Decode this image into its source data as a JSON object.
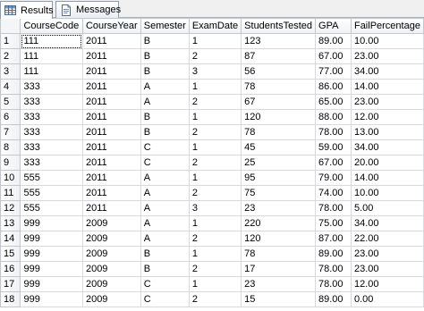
{
  "tabs": [
    {
      "label": "Results",
      "icon": "grid-results-icon",
      "active": true
    },
    {
      "label": "Messages",
      "icon": "messages-icon",
      "active": false
    }
  ],
  "grid": {
    "columns": [
      "CourseCode",
      "CourseYear",
      "Semester",
      "ExamDate",
      "StudentsTested",
      "GPA",
      "FailPercentage"
    ],
    "rows": [
      {
        "num": "1",
        "cells": [
          "111",
          "2011",
          "B",
          "1",
          "123",
          "89.00",
          "10.00"
        ]
      },
      {
        "num": "2",
        "cells": [
          "111",
          "2011",
          "B",
          "2",
          "87",
          "67.00",
          "23.00"
        ]
      },
      {
        "num": "3",
        "cells": [
          "111",
          "2011",
          "B",
          "3",
          "56",
          "77.00",
          "34.00"
        ]
      },
      {
        "num": "4",
        "cells": [
          "333",
          "2011",
          "A",
          "1",
          "78",
          "86.00",
          "14.00"
        ]
      },
      {
        "num": "5",
        "cells": [
          "333",
          "2011",
          "A",
          "2",
          "67",
          "65.00",
          "23.00"
        ]
      },
      {
        "num": "6",
        "cells": [
          "333",
          "2011",
          "B",
          "1",
          "120",
          "88.00",
          "12.00"
        ]
      },
      {
        "num": "7",
        "cells": [
          "333",
          "2011",
          "B",
          "2",
          "78",
          "78.00",
          "13.00"
        ]
      },
      {
        "num": "8",
        "cells": [
          "333",
          "2011",
          "C",
          "1",
          "45",
          "59.00",
          "34.00"
        ]
      },
      {
        "num": "9",
        "cells": [
          "333",
          "2011",
          "C",
          "2",
          "25",
          "67.00",
          "20.00"
        ]
      },
      {
        "num": "10",
        "cells": [
          "555",
          "2011",
          "A",
          "1",
          "95",
          "79.00",
          "14.00"
        ]
      },
      {
        "num": "11",
        "cells": [
          "555",
          "2011",
          "A",
          "2",
          "75",
          "74.00",
          "10.00"
        ]
      },
      {
        "num": "12",
        "cells": [
          "555",
          "2011",
          "A",
          "3",
          "23",
          "78.00",
          "5.00"
        ]
      },
      {
        "num": "13",
        "cells": [
          "999",
          "2009",
          "A",
          "1",
          "220",
          "75.00",
          "34.00"
        ]
      },
      {
        "num": "14",
        "cells": [
          "999",
          "2009",
          "A",
          "2",
          "120",
          "87.00",
          "22.00"
        ]
      },
      {
        "num": "15",
        "cells": [
          "999",
          "2009",
          "B",
          "1",
          "78",
          "89.00",
          "23.00"
        ]
      },
      {
        "num": "16",
        "cells": [
          "999",
          "2009",
          "B",
          "2",
          "17",
          "78.00",
          "23.00"
        ]
      },
      {
        "num": "17",
        "cells": [
          "999",
          "2009",
          "C",
          "1",
          "23",
          "78.00",
          "12.00"
        ]
      },
      {
        "num": "18",
        "cells": [
          "999",
          "2009",
          "C",
          "2",
          "15",
          "89.00",
          "0.00"
        ]
      }
    ]
  },
  "colors": {
    "tab_border": "#8d9aaa",
    "grid_line": "#d6d9dd",
    "header_bg": "#eef0f3"
  }
}
